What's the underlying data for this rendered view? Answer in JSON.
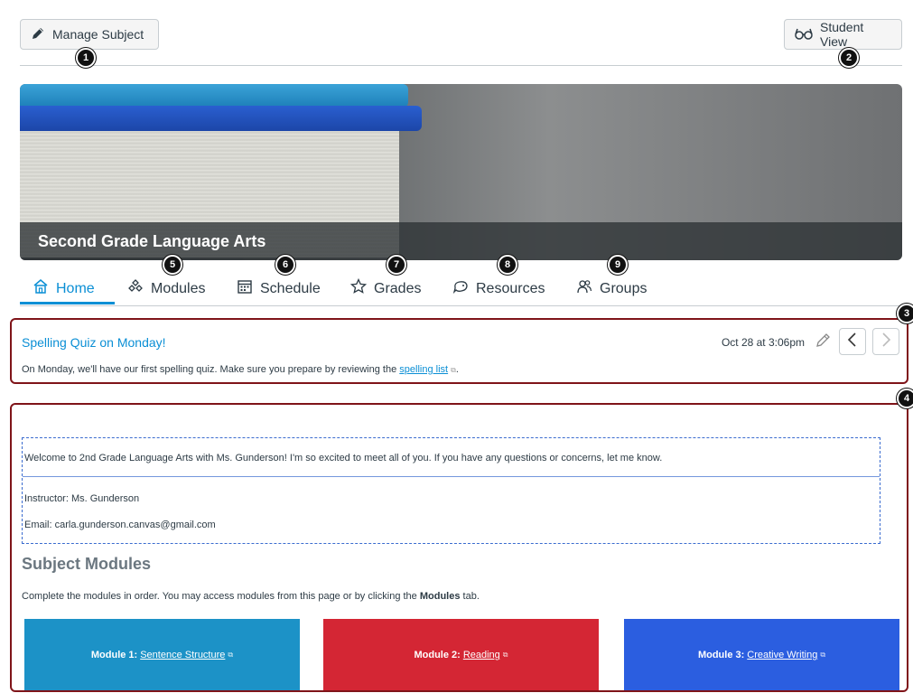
{
  "toolbar": {
    "manage_label": "Manage Subject",
    "student_view_label": "Student View"
  },
  "hero": {
    "title": "Second Grade Language Arts"
  },
  "tabs": [
    {
      "label": "Home",
      "icon": "home-icon",
      "active": true
    },
    {
      "label": "Modules",
      "icon": "modules-icon",
      "active": false
    },
    {
      "label": "Schedule",
      "icon": "calendar-icon",
      "active": false
    },
    {
      "label": "Grades",
      "icon": "star-icon",
      "active": false
    },
    {
      "label": "Resources",
      "icon": "resources-icon",
      "active": false
    },
    {
      "label": "Groups",
      "icon": "groups-icon",
      "active": false
    }
  ],
  "callouts": [
    "1",
    "2",
    "3",
    "4",
    "5",
    "6",
    "7",
    "8",
    "9"
  ],
  "announcement": {
    "title": "Spelling Quiz on Monday!",
    "date": "Oct 28 at 3:06pm",
    "body_prefix": "On Monday, we'll have our first spelling quiz. Make sure you prepare by reviewing the ",
    "link_text": "spelling list",
    "body_suffix": "."
  },
  "home": {
    "welcome": "Welcome to 2nd Grade Language Arts with Ms. Gunderson! I'm so excited to meet all of you. If you have any questions or concerns, let me know.",
    "instructor": "Instructor: Ms. Gunderson",
    "email": "Email: carla.gunderson.canvas@gmail.com",
    "modules_heading": "Subject Modules",
    "modules_intro_prefix": "Complete the modules in order. You may access modules from this page or by clicking the ",
    "modules_intro_bold": "Modules",
    "modules_intro_suffix": " tab.",
    "modules": [
      {
        "prefix": "Module 1:",
        "link": "Sentence Structure",
        "color": "#1c92c7"
      },
      {
        "prefix": "Module 2:",
        "link": "Reading",
        "color": "#d42634"
      },
      {
        "prefix": "Module 3:",
        "link": "Creative Writing",
        "color": "#2b5ee0"
      }
    ]
  },
  "colors": {
    "accent": "#0b8fd5",
    "highlight_border": "#7f1419"
  }
}
